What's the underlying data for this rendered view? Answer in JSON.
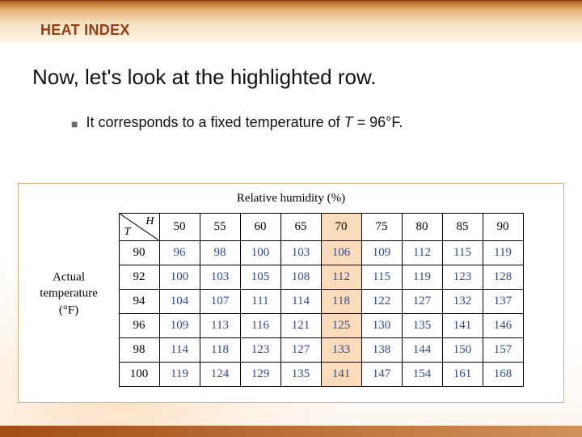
{
  "title_bar": {
    "label": "HEAT INDEX"
  },
  "headline": "Now, let's look at the highlighted row.",
  "bullet": {
    "prefix": "It corresponds to a fixed temperature of ",
    "var": "T",
    "suffix": " = 96°F."
  },
  "labels": {
    "top": "Relative humidity (%)",
    "side_line1": "Actual",
    "side_line2": "temperature",
    "side_line3": "(°F)",
    "corner_H": "H",
    "corner_T": "T"
  },
  "chart_data": {
    "type": "table",
    "title": "Heat Index",
    "xlabel": "Relative humidity (%)",
    "ylabel": "Actual temperature (°F)",
    "columns": [
      50,
      55,
      60,
      65,
      70,
      75,
      80,
      85,
      90
    ],
    "rows": [
      90,
      92,
      94,
      96,
      98,
      100
    ],
    "values": [
      [
        96,
        98,
        100,
        103,
        106,
        109,
        112,
        115,
        119
      ],
      [
        100,
        103,
        105,
        108,
        112,
        115,
        119,
        123,
        128
      ],
      [
        104,
        107,
        111,
        114,
        118,
        122,
        127,
        132,
        137
      ],
      [
        109,
        113,
        116,
        121,
        125,
        130,
        135,
        141,
        146
      ],
      [
        114,
        118,
        123,
        127,
        133,
        138,
        144,
        150,
        157
      ],
      [
        119,
        124,
        129,
        135,
        141,
        147,
        154,
        161,
        168
      ]
    ],
    "highlight_row_index": 3,
    "highlight_col_index": 4
  }
}
